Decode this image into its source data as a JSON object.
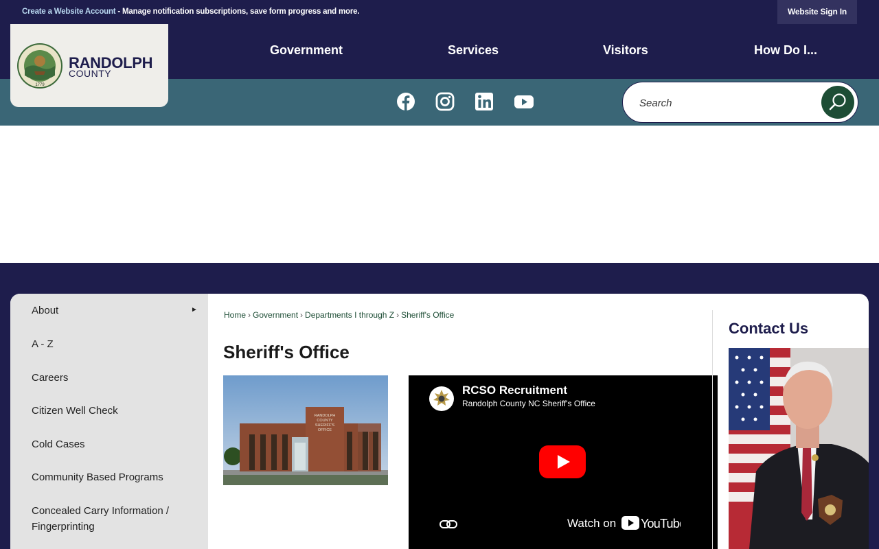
{
  "topbar": {
    "create_link": "Create a Website Account",
    "message": " - Manage notification subscriptions, save form progress and more.",
    "signin": "Website Sign In"
  },
  "logo": {
    "name_line1": "RANDOLPH",
    "name_line2": "COUNTY",
    "seal_text": "RANDOLPH COUNTY, NORTH CAROLINA",
    "seal_year": "1779"
  },
  "nav": {
    "items": [
      "Government",
      "Services",
      "Visitors",
      "How Do I..."
    ]
  },
  "social": {
    "icons": [
      "facebook-icon",
      "instagram-icon",
      "linkedin-icon",
      "youtube-icon"
    ]
  },
  "search": {
    "placeholder": "Search"
  },
  "sidebar": {
    "items": [
      {
        "label": "About"
      },
      {
        "label": "A - Z"
      },
      {
        "label": "Careers"
      },
      {
        "label": "Citizen Well Check"
      },
      {
        "label": "Cold Cases"
      },
      {
        "label": "Community Based Programs"
      },
      {
        "label": "Concealed Carry Information / Fingerprinting"
      }
    ]
  },
  "breadcrumb": [
    "Home",
    "Government",
    "Departments I through Z",
    "Sheriff's Office"
  ],
  "page": {
    "title": "Sheriff's Office"
  },
  "building_sign": {
    "line1": "RANDOLPH",
    "line2": "COUNTY",
    "line3": "SHERIFF'S",
    "line4": "OFFICE"
  },
  "video": {
    "title": "RCSO Recruitment",
    "channel": "Randolph County NC Sheriff's Office",
    "watch_on": "Watch on",
    "brand": "YouTube"
  },
  "contact": {
    "title": "Contact Us"
  },
  "colors": {
    "navy": "#1e1d4c",
    "teal": "#3a6676",
    "green": "#1d4d35"
  }
}
